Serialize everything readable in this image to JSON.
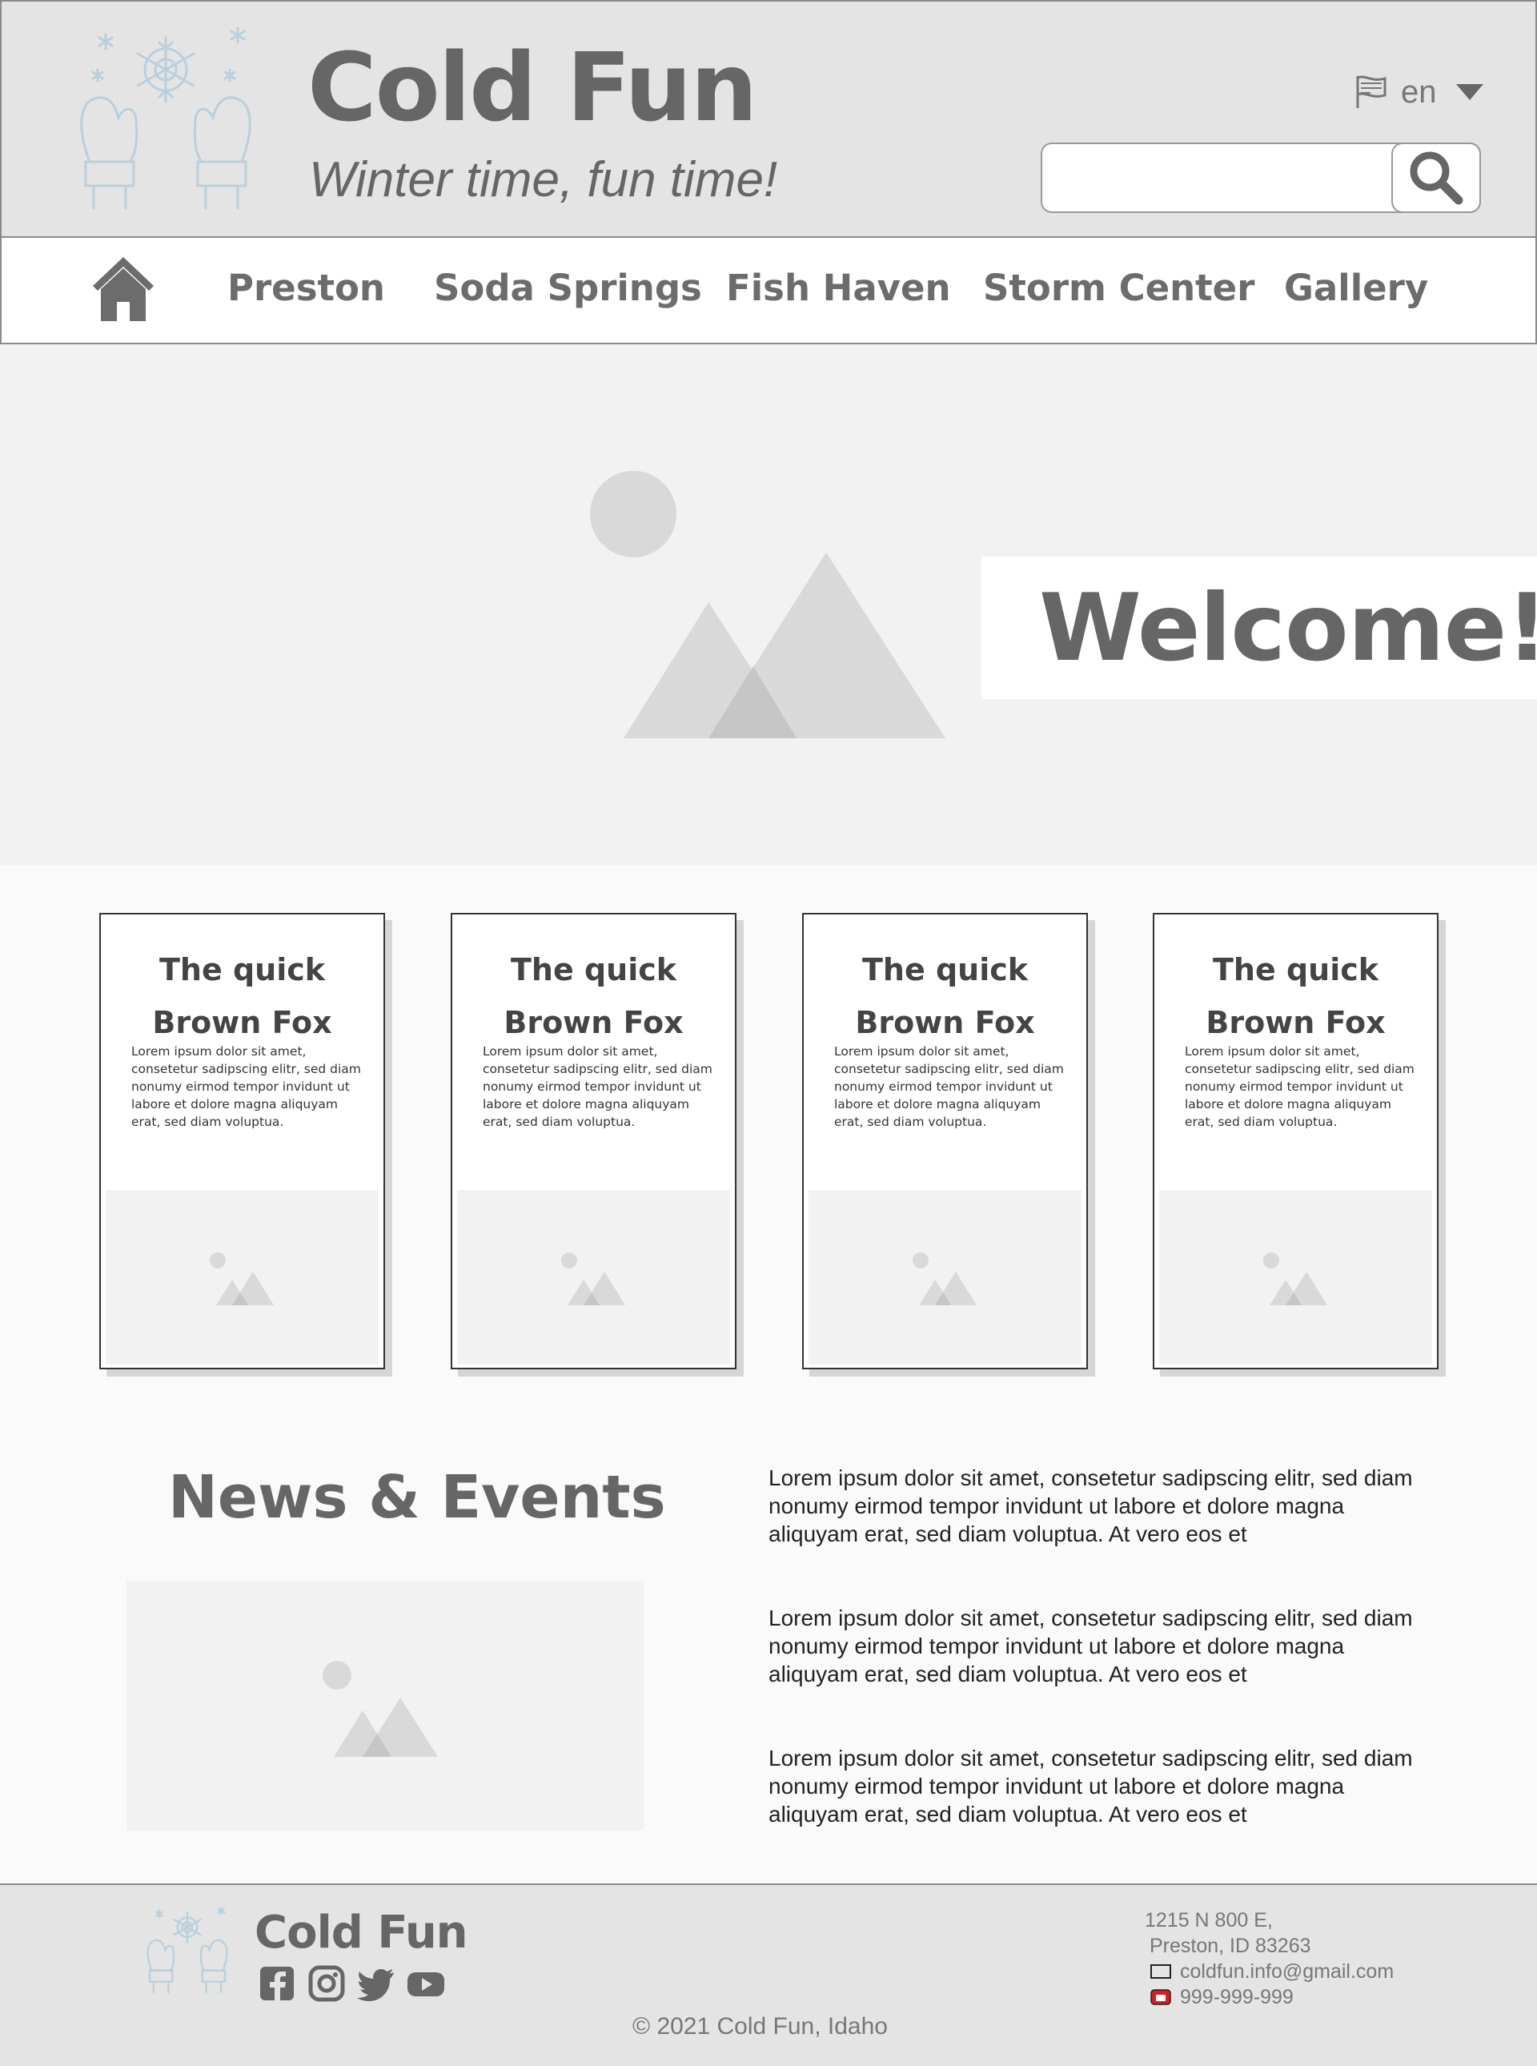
{
  "header": {
    "site_title": "Cold Fun",
    "tagline": "Winter time, fun time!",
    "language": "en",
    "search_value": ""
  },
  "nav": {
    "items": [
      "Preston",
      "Soda Springs",
      "Fish Haven",
      "Storm Center",
      "Gallery"
    ]
  },
  "hero": {
    "welcome": "Welcome!"
  },
  "cards": [
    {
      "title_line1": "The quick",
      "title_line2": "Brown Fox",
      "text": "Lorem ipsum dolor sit amet, consetetur sadipscing elitr, sed diam nonumy eirmod tempor invidunt ut labore et dolore magna aliquyam erat, sed diam voluptua."
    },
    {
      "title_line1": "The quick",
      "title_line2": "Brown Fox",
      "text": "Lorem ipsum dolor sit amet, consetetur sadipscing elitr, sed diam nonumy eirmod tempor invidunt ut labore et dolore magna aliquyam erat, sed diam voluptua."
    },
    {
      "title_line1": "The quick",
      "title_line2": "Brown Fox",
      "text": "Lorem ipsum dolor sit amet, consetetur sadipscing elitr, sed diam nonumy eirmod tempor invidunt ut labore et dolore magna aliquyam erat, sed diam voluptua."
    },
    {
      "title_line1": "The quick",
      "title_line2": "Brown Fox",
      "text": "Lorem ipsum dolor sit amet, consetetur sadipscing elitr, sed diam nonumy eirmod tempor invidunt ut labore et dolore magna aliquyam erat, sed diam voluptua."
    }
  ],
  "news": {
    "title": "News & Events",
    "paragraphs": [
      "Lorem ipsum dolor sit amet, consetetur sadipscing elitr, sed diam nonumy eirmod tempor invidunt ut labore et dolore magna aliquyam erat, sed diam voluptua. At vero eos et",
      "Lorem ipsum dolor sit amet, consetetur sadipscing elitr, sed diam nonumy eirmod tempor invidunt ut labore et dolore magna aliquyam erat, sed diam voluptua. At vero eos et",
      "Lorem ipsum dolor sit amet, consetetur sadipscing elitr, sed diam nonumy eirmod tempor invidunt ut labore et dolore magna aliquyam erat, sed diam voluptua. At vero eos et"
    ]
  },
  "footer": {
    "name": "Cold Fun",
    "address_line1": "1215 N 800 E,",
    "address_line2": "Preston, ID 83263",
    "email": "coldfun.info@gmail.com",
    "phone": "999-999-999",
    "copyright": "©  2021 Cold Fun, Idaho",
    "social_icons": [
      "facebook-icon",
      "instagram-icon",
      "twitter-icon",
      "youtube-icon"
    ]
  },
  "colors": {
    "header_bg": "#e4e4e4",
    "text_gray": "#666666",
    "logo_blue": "#b9d0dc",
    "placeholder_bg": "#f2f2f2"
  }
}
